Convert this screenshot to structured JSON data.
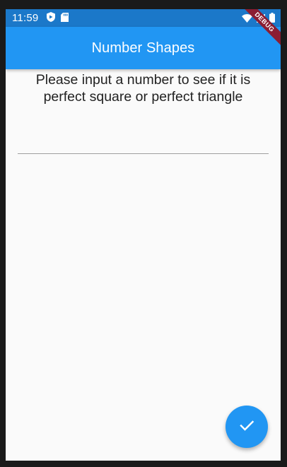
{
  "status_bar": {
    "time": "11:59",
    "left_icons": [
      "shield-icon",
      "sd-card-icon"
    ],
    "right_icons": [
      "wifi-icon",
      "signal-icon",
      "battery-icon"
    ]
  },
  "app_bar": {
    "title": "Number Shapes"
  },
  "debug_banner": {
    "label": "DEBUG"
  },
  "main": {
    "prompt": "Please input a number to see if it is perfect square or perfect triangle",
    "number_input": {
      "value": "",
      "placeholder": ""
    }
  },
  "fab": {
    "icon": "check-icon"
  },
  "colors": {
    "primary": "#2196f3",
    "status_bar": "#1b78c9",
    "debug_banner": "#8b1d33",
    "background": "#fafafa"
  }
}
